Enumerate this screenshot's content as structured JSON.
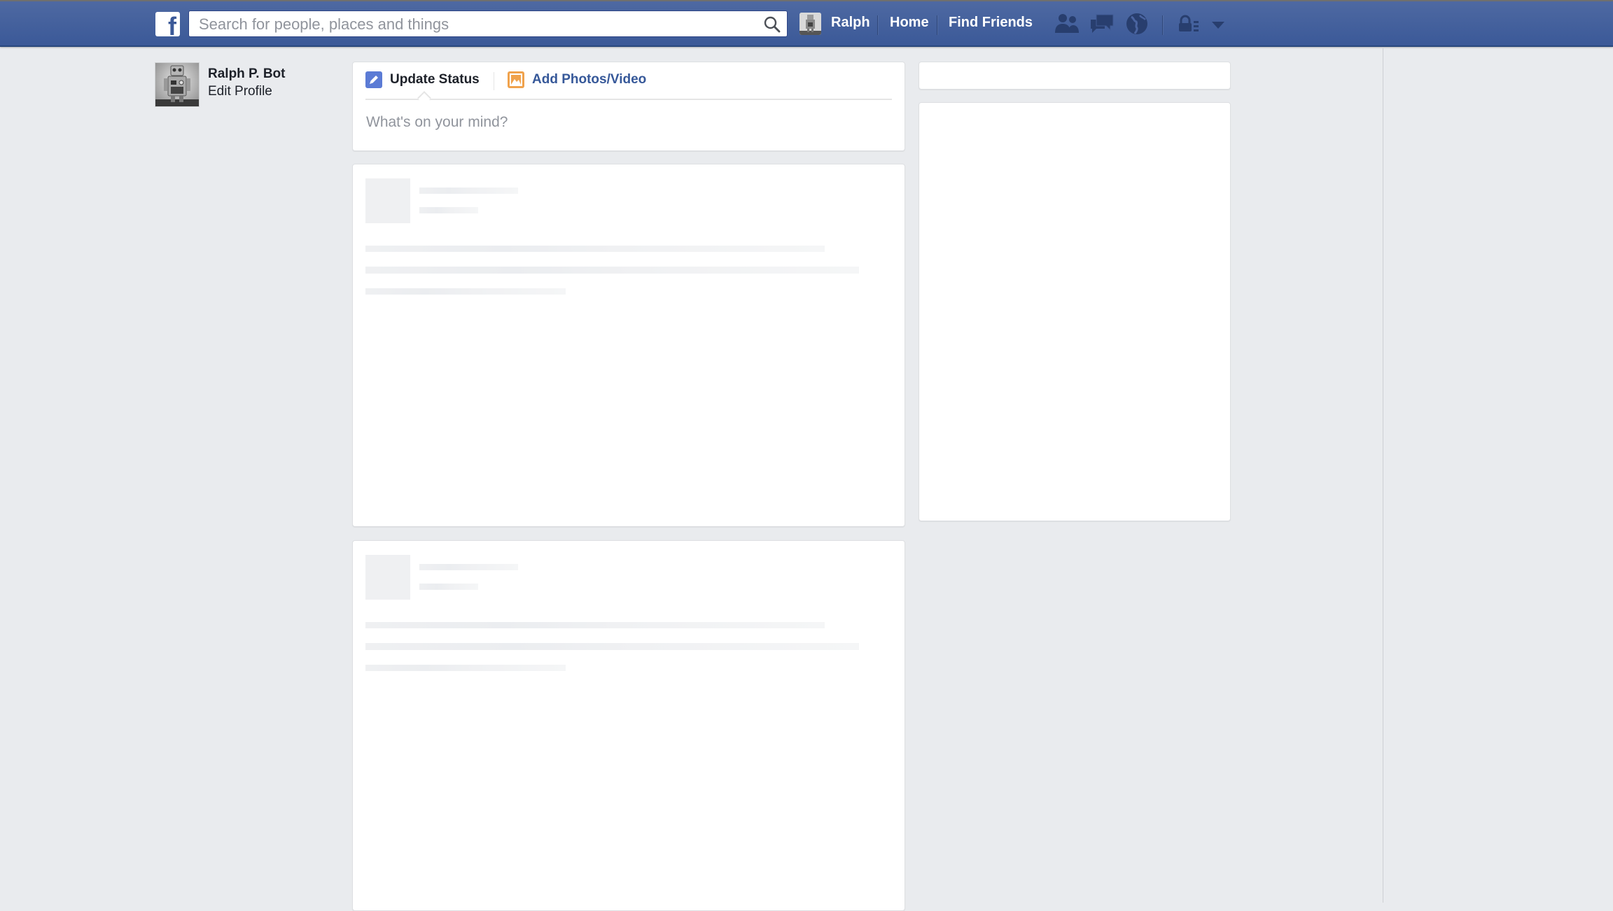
{
  "header": {
    "logo": "f",
    "search": {
      "placeholder": "Search for people, places and things",
      "value": ""
    },
    "user_name": "Ralph",
    "nav": [
      {
        "label": "Home"
      },
      {
        "label": "Find Friends"
      }
    ],
    "icons": [
      "friend-requests-icon",
      "messages-icon",
      "notifications-globe-icon",
      "privacy-shortcuts-icon",
      "account-dropdown-icon"
    ],
    "colors": {
      "bar": "#3b5998",
      "icon": "#283e6e"
    }
  },
  "sidebar": {
    "profile_name": "Ralph P. Bot",
    "edit_profile": "Edit Profile"
  },
  "composer": {
    "tabs": [
      {
        "label": "Update Status",
        "icon": "pencil-icon",
        "active": true
      },
      {
        "label": "Add Photos/Video",
        "icon": "photo-icon",
        "active": false
      }
    ],
    "placeholder": "What's on your mind?",
    "colors": {
      "status_icon": "#5b7bd5",
      "photo_icon": "#f0a24c",
      "link": "#365899"
    }
  },
  "feed": {
    "loading_placeholders": 2
  }
}
